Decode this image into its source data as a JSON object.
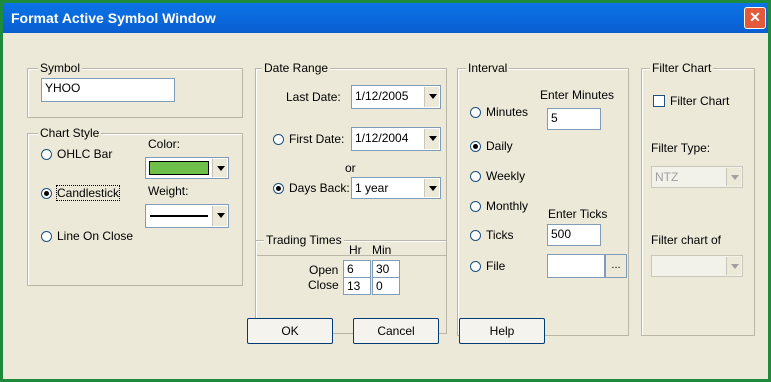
{
  "window": {
    "title": "Format Active Symbol Window",
    "close_glyph": "✕"
  },
  "symbol": {
    "legend": "Symbol",
    "value": "YHOO"
  },
  "chart_style": {
    "legend": "Chart Style",
    "options": [
      "OHLC Bar",
      "Candlestick",
      "Line On Close"
    ],
    "selected": "Candlestick",
    "color_label": "Color:",
    "color_value": "#6fc04b",
    "weight_label": "Weight:"
  },
  "date_range": {
    "legend": "Date Range",
    "last_date_label": "Last Date:",
    "last_date_value": "1/12/2005",
    "first_date_label": "First Date:",
    "first_date_value": "1/12/2004",
    "or_label": "or",
    "days_back_label": "Days Back:",
    "days_back_value": "1 year",
    "selected": "Days Back"
  },
  "trading_times": {
    "legend": "Trading Times",
    "hr_label": "Hr",
    "min_label": "Min",
    "open_label": "Open",
    "close_label": "Close",
    "open_hr": "6",
    "open_min": "30",
    "close_hr": "13",
    "close_min": "0"
  },
  "interval": {
    "legend": "Interval",
    "options": [
      "Minutes",
      "Daily",
      "Weekly",
      "Monthly",
      "Ticks",
      "File"
    ],
    "selected": "Daily",
    "enter_minutes_label": "Enter Minutes",
    "minutes_value": "5",
    "enter_ticks_label": "Enter Ticks",
    "ticks_value": "500",
    "file_value": "",
    "browse_label": "..."
  },
  "filter_chart": {
    "legend": "Filter Chart",
    "checkbox_label": "Filter Chart",
    "checked": false,
    "filter_type_label": "Filter Type:",
    "filter_type_value": "NTZ",
    "filter_chart_of_label": "Filter chart of",
    "filter_chart_of_value": ""
  },
  "buttons": {
    "ok": "OK",
    "cancel": "Cancel",
    "help": "Help"
  }
}
